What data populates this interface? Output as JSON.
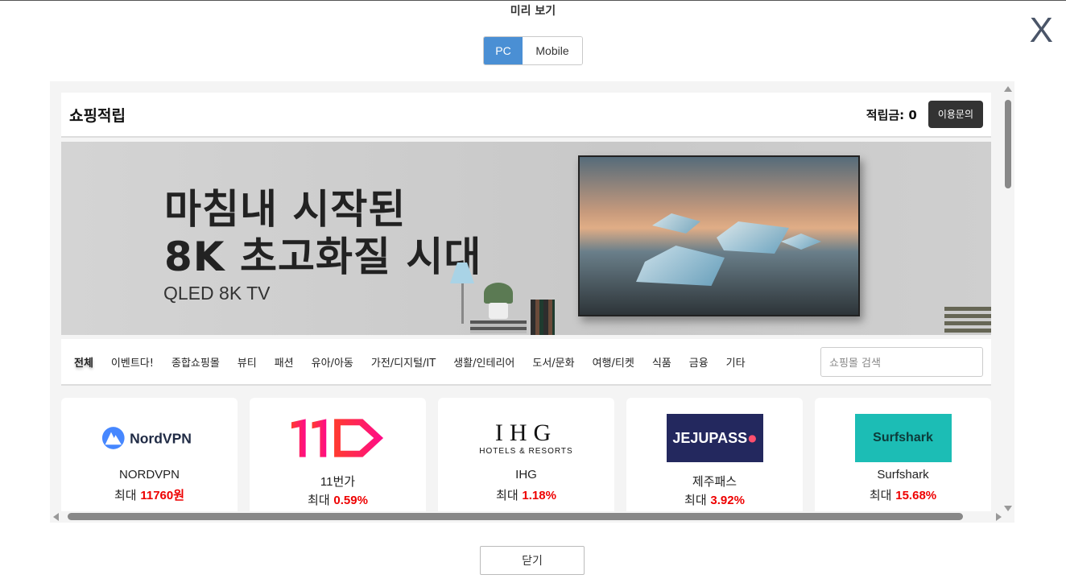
{
  "modal": {
    "title": "미리 보기",
    "close_x": "X",
    "toggle": {
      "pc": "PC",
      "mobile": "Mobile",
      "selected": "PC"
    },
    "close_button": "닫기"
  },
  "site": {
    "brand": "쇼핑적립",
    "points_label": "적립금: 0",
    "inquiry_button": "이용문의"
  },
  "banner": {
    "line1": "마침내 시작된",
    "line2": "8K 초고화질 시대",
    "sub": "QLED 8K TV"
  },
  "categories": [
    "전체",
    "이벤트다!",
    "종합쇼핑몰",
    "뷰티",
    "패션",
    "유아/아동",
    "가전/디지털/IT",
    "생활/인테리어",
    "도서/문화",
    "여행/티켓",
    "식품",
    "금융",
    "기타"
  ],
  "search": {
    "placeholder": "쇼핑몰 검색"
  },
  "cards": [
    {
      "name": "NORDVPN",
      "prefix": "최대 ",
      "rate": "11760원",
      "logo_text": "NordVPN"
    },
    {
      "name": "11번가",
      "prefix": "최대 ",
      "rate": "0.59%",
      "logo_text": "11"
    },
    {
      "name": "IHG",
      "prefix": "최대 ",
      "rate": "1.18%",
      "logo_text": "IHG",
      "logo_sub": "HOTELS & RESORTS"
    },
    {
      "name": "제주패스",
      "prefix": "최대 ",
      "rate": "3.92%",
      "logo_text": "JEJUPASS"
    },
    {
      "name": "Surfshark",
      "prefix": "최대 ",
      "rate": "15.68%",
      "logo_text": "Surfshark"
    }
  ],
  "colors": {
    "accent": "#4a8fd4",
    "rate_red": "#e00000",
    "dark_button": "#333333"
  }
}
